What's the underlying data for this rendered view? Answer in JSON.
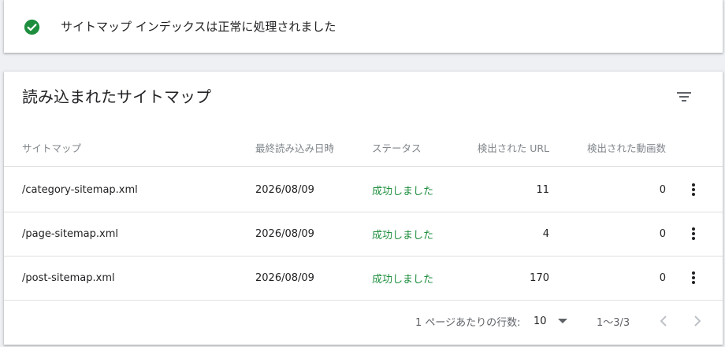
{
  "colors": {
    "success": "#1e8e3e",
    "text_primary": "#202124",
    "text_secondary": "#5f6368",
    "header_text": "#80868b",
    "divider": "#e0e0e0",
    "page_bg": "#eef0f4"
  },
  "banner": {
    "icon": "check-circle-icon",
    "message": "サイトマップ インデックスは正常に処理されました"
  },
  "card": {
    "title": "読み込まれたサイトマップ",
    "filter_icon": "filter-icon",
    "columns": {
      "name": "サイトマップ",
      "last_read": "最終読み込み日時",
      "status": "ステータス",
      "urls": "検出された URL",
      "videos": "検出された動画数"
    },
    "rows": [
      {
        "name": "/category-sitemap.xml",
        "last_read": "2026/08/09",
        "status": "成功しました",
        "urls": "11",
        "videos": "0"
      },
      {
        "name": "/page-sitemap.xml",
        "last_read": "2026/08/09",
        "status": "成功しました",
        "urls": "4",
        "videos": "0"
      },
      {
        "name": "/post-sitemap.xml",
        "last_read": "2026/08/09",
        "status": "成功しました",
        "urls": "170",
        "videos": "0"
      }
    ],
    "row_menu_icon": "more-vert-icon"
  },
  "pagination": {
    "rows_per_page_label": "1 ページあたりの行数:",
    "rows_per_page_value": "10",
    "range": "1～3/3",
    "prev_icon": "chevron-left-icon",
    "next_icon": "chevron-right-icon"
  }
}
